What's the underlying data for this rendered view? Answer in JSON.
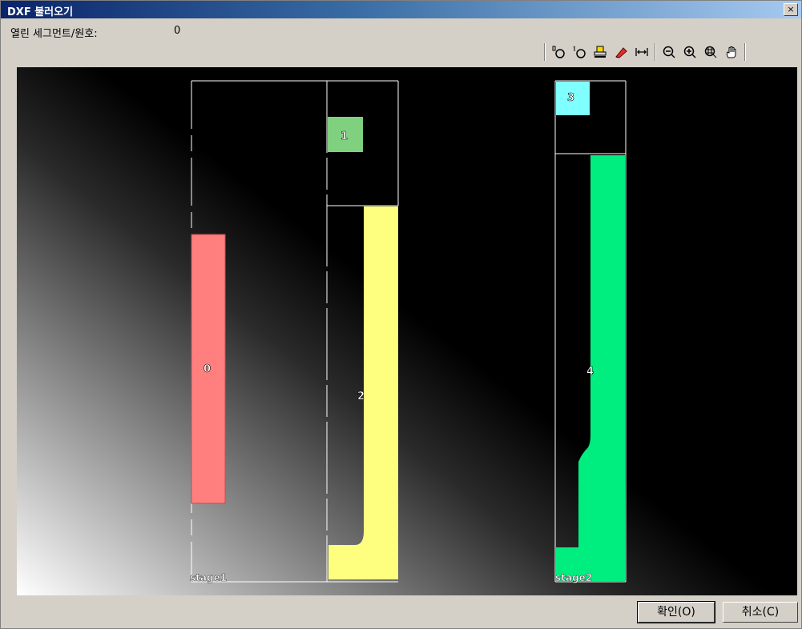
{
  "window": {
    "title": "DXF 불러오기",
    "close_label": "×"
  },
  "status": {
    "label": "열린 세그먼트/원호:",
    "value": "0"
  },
  "toolbar": {
    "icons": [
      "point-start-icon",
      "point-end-icon",
      "print-icon",
      "eraser-icon",
      "fit-width-icon",
      "zoom-out-icon",
      "zoom-in-icon",
      "zoom-extents-icon",
      "pan-hand-icon"
    ]
  },
  "canvas": {
    "segments": [
      {
        "label": "0",
        "color": "#ff7f7f"
      },
      {
        "label": "1",
        "color": "#7fd17f"
      },
      {
        "label": "2",
        "color": "#ffff7f"
      },
      {
        "label": "3",
        "color": "#7fffff"
      },
      {
        "label": "4",
        "color": "#00ee80"
      }
    ],
    "stages": [
      {
        "label": "stage1"
      },
      {
        "label": "stage2"
      }
    ]
  },
  "buttons": {
    "ok": "확인(O)",
    "cancel": "취소(C)"
  }
}
